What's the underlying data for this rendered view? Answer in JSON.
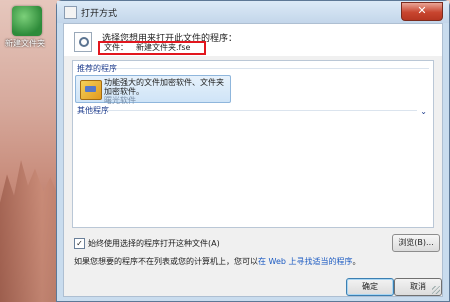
{
  "desktop": {
    "icon_label": "新建文件夹"
  },
  "window": {
    "title": "打开方式",
    "close_glyph": "✕"
  },
  "header": {
    "prompt": "选择您想用来打开此文件的程序：",
    "file_label": "文件：",
    "file_name": "新建文件夹.fse"
  },
  "groups": {
    "recommended_label": "推荐的程序",
    "other_label": "其他程序",
    "expand_icon": "chevron-down-icon"
  },
  "program": {
    "name": "功能强大的文件加密软件、文件夹加密软件。",
    "vendor": "曙光软件"
  },
  "options": {
    "always_use_label": "始终使用选择的程序打开这种文件(A)",
    "always_use_checked": true,
    "browse_label": "浏览(B)..."
  },
  "hint": {
    "text": "如果您想要的程序不在列表或您的计算机上，您可以",
    "link": "在 Web 上寻找适当的程序",
    "suffix": "。"
  },
  "buttons": {
    "ok": "确定",
    "cancel": "取消"
  },
  "colors": {
    "highlight_border": "#e2161d",
    "link": "#1b5ac2",
    "group_header": "#1c3b8c"
  }
}
